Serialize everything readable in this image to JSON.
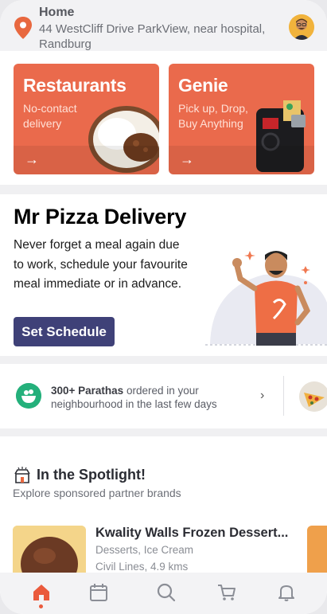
{
  "header": {
    "title": "Home",
    "address": "44 WestCliff Drive ParkView, near hospital, Randburg"
  },
  "tiles": [
    {
      "title": "Restaurants",
      "subtitle": "No-contact delivery",
      "arrow": "→"
    },
    {
      "title": "Genie",
      "subtitle": "Pick up, Drop, Buy Anything",
      "arrow": "→"
    }
  ],
  "promo": {
    "title": "Mr Pizza Delivery",
    "text": "Never forget a meal again due to work, schedule your favourite meal immediate or in advance.",
    "button": "Set Schedule"
  },
  "parathas": {
    "highlight": "300+ Parathas",
    "text": " ordered in your neighbourhood in the last few days",
    "chevron": "›"
  },
  "spotlight": {
    "title": "In the Spotlight!",
    "subtitle": "Explore sponsored partner brands",
    "card": {
      "name": "Kwality Walls Frozen Dessert...",
      "category": "Desserts, Ice Cream",
      "location": "Civil Lines, 4.9 kms"
    }
  },
  "nav": {
    "items": [
      "home-icon",
      "calendar-icon",
      "search-icon",
      "cart-icon",
      "bell-icon"
    ],
    "active": "home-icon",
    "active_color": "#ea5a3c"
  },
  "colors": {
    "accent": "#ea6a4c",
    "button": "#3f4178",
    "pin": "#e8683f"
  }
}
